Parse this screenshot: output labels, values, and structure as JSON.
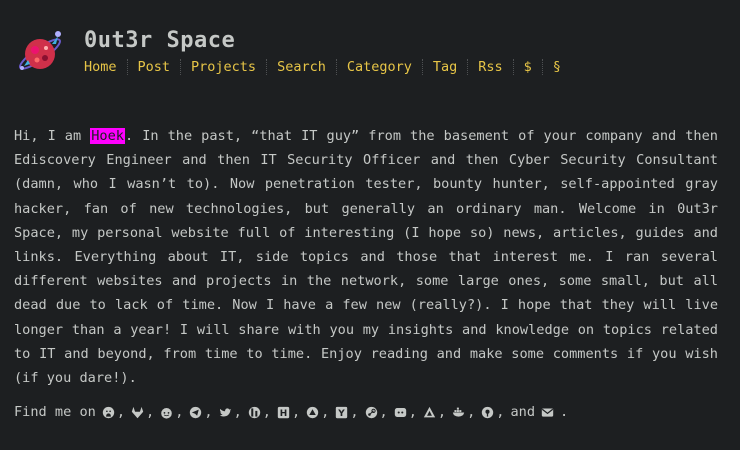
{
  "header": {
    "title": "0ut3r Space",
    "nav": [
      {
        "label": "Home",
        "name": "nav-home"
      },
      {
        "label": "Post",
        "name": "nav-post"
      },
      {
        "label": "Projects",
        "name": "nav-projects"
      },
      {
        "label": "Search",
        "name": "nav-search"
      },
      {
        "label": "Category",
        "name": "nav-category"
      },
      {
        "label": "Tag",
        "name": "nav-tag"
      },
      {
        "label": "Rss",
        "name": "nav-rss"
      },
      {
        "label": "$",
        "name": "nav-donate"
      },
      {
        "label": "§",
        "name": "nav-legal"
      }
    ]
  },
  "intro": {
    "before": "Hi, I am ",
    "name": "Hoek",
    "after": ". In the past, “that IT guy” from the basement of your company and then Ediscovery Engineer and then IT Security Officer and then Cyber Security Consultant (damn, who I wasn’t to). Now penetration tester, bounty hunter, self-appointed gray hacker, fan of new technologies, but generally an ordinary man. Welcome in 0ut3r Space, my personal website full of interesting (I hope so) news, articles, guides and links. Everything about IT, side topics and those that interest me. I ran several different websites and projects in the network, some large ones, some small, but all dead due to lack of time. Now I have a few new (really?). I hope that they will live longer than a year! I will share with you my insights and knowledge on topics related to IT and beyond, from time to time. Enjoy reading and make some comments if you wish (if you dare!)."
  },
  "find_me": {
    "prefix": "Find me on",
    "and": "and",
    "end": ".",
    "icons": [
      "github-icon",
      "gitlab-icon",
      "reddit-icon",
      "telegram-icon",
      "twitter-icon",
      "hackerone-icon",
      "hackthebox-icon",
      "tryhackme-icon",
      "ycombinator-icon",
      "steam-icon",
      "discord-icon",
      "codeberg-icon",
      "docker-icon",
      "keybase-icon"
    ],
    "last_icon": "email-icon"
  },
  "colors": {
    "background": "#1d1f21",
    "text": "#c5c8c6",
    "nav_link": "#e7c547",
    "highlight": "#ff00ff"
  }
}
